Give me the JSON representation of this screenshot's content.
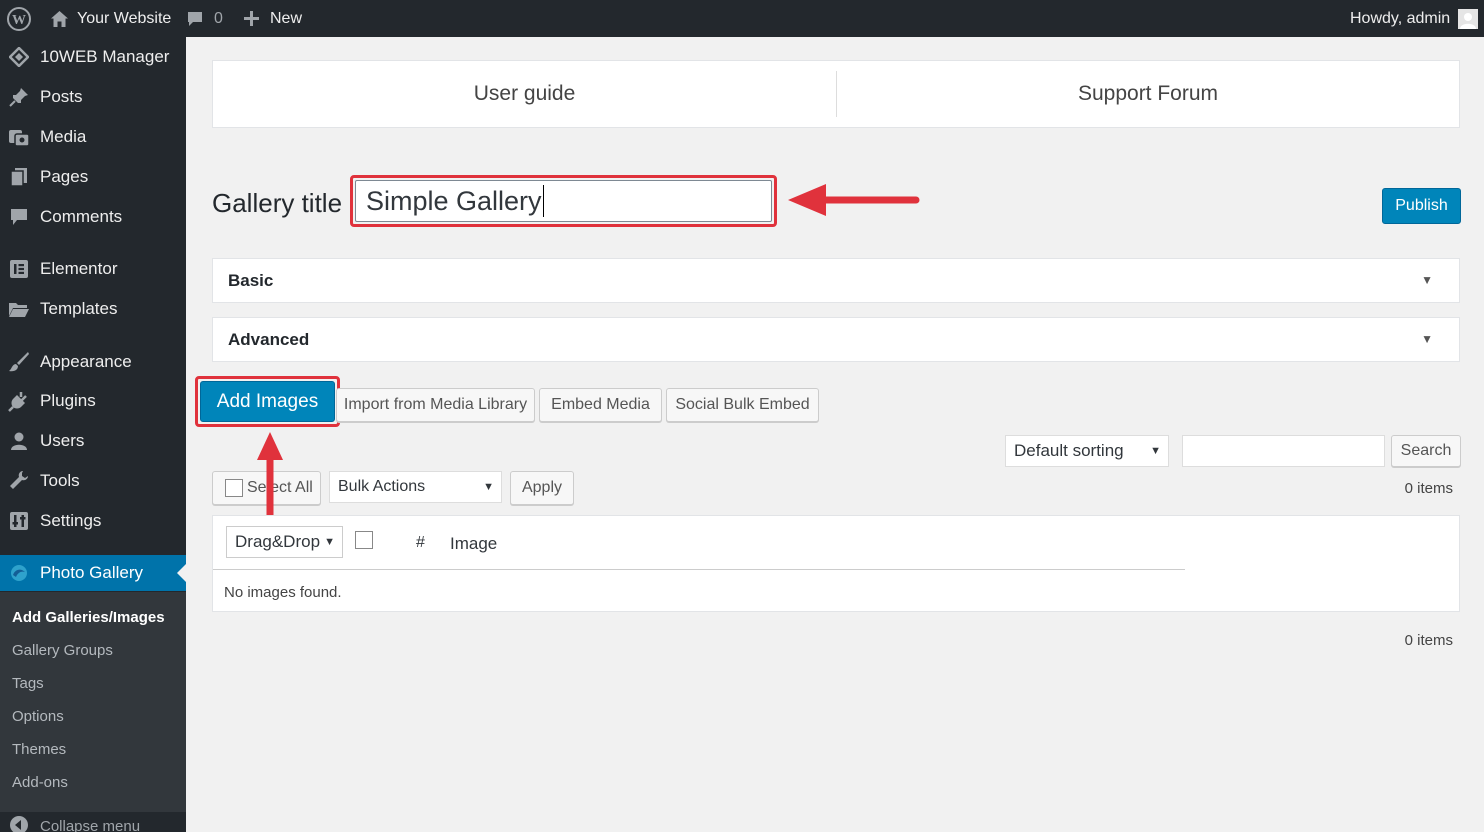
{
  "adminbar": {
    "site_name": "Your Website",
    "comments_count": "0",
    "new_label": "New",
    "howdy": "Howdy, admin",
    "icons": [
      "wordpress-logo-icon",
      "home-icon",
      "comment-bubble-icon",
      "plus-icon",
      "avatar-icon"
    ]
  },
  "sidebar": {
    "items": [
      {
        "label": "10WEB Manager",
        "icon": "diamond-icon"
      },
      {
        "label": "Posts",
        "icon": "pushpin-icon"
      },
      {
        "label": "Media",
        "icon": "media-icon"
      },
      {
        "label": "Pages",
        "icon": "pages-icon"
      },
      {
        "label": "Comments",
        "icon": "comment-icon"
      },
      {
        "label": "Elementor",
        "icon": "elementor-icon"
      },
      {
        "label": "Templates",
        "icon": "folder-icon"
      },
      {
        "label": "Appearance",
        "icon": "paintbrush-icon"
      },
      {
        "label": "Plugins",
        "icon": "plug-icon"
      },
      {
        "label": "Users",
        "icon": "users-icon"
      },
      {
        "label": "Tools",
        "icon": "wrench-icon"
      },
      {
        "label": "Settings",
        "icon": "settings-icon"
      },
      {
        "label": "Photo Gallery",
        "icon": "photo-gallery-icon"
      }
    ],
    "submenu": [
      "Add Galleries/Images",
      "Gallery Groups",
      "Tags",
      "Options",
      "Themes",
      "Add-ons"
    ],
    "collapse_label": "Collapse menu"
  },
  "tabs": {
    "user_guide": "User guide",
    "support_forum": "Support Forum"
  },
  "gallery": {
    "title_label": "Gallery title",
    "title_value": "Simple Gallery",
    "publish_label": "Publish"
  },
  "sections": {
    "basic": "Basic",
    "advanced": "Advanced"
  },
  "image_buttons": {
    "add_images": "Add Images",
    "import_media": "Import from Media Library",
    "embed_media": "Embed Media",
    "social_bulk": "Social Bulk Embed"
  },
  "filters": {
    "sorting_value": "Default sorting",
    "search_value": "",
    "search_label": "Search",
    "select_all_label": "Select All",
    "bulk_actions_value": "Bulk Actions",
    "apply_label": "Apply",
    "items_count_top": "0 items",
    "items_count_bottom": "0 items"
  },
  "table": {
    "order_value": "Drag&Drop",
    "hash_label": "#",
    "image_label": "Image",
    "empty_message": "No images found."
  },
  "colors": {
    "sidebar_bg": "#23282d",
    "active_blue": "#0073aa",
    "highlight_red": "#e0323c",
    "content_bg": "#f1f1f1"
  }
}
